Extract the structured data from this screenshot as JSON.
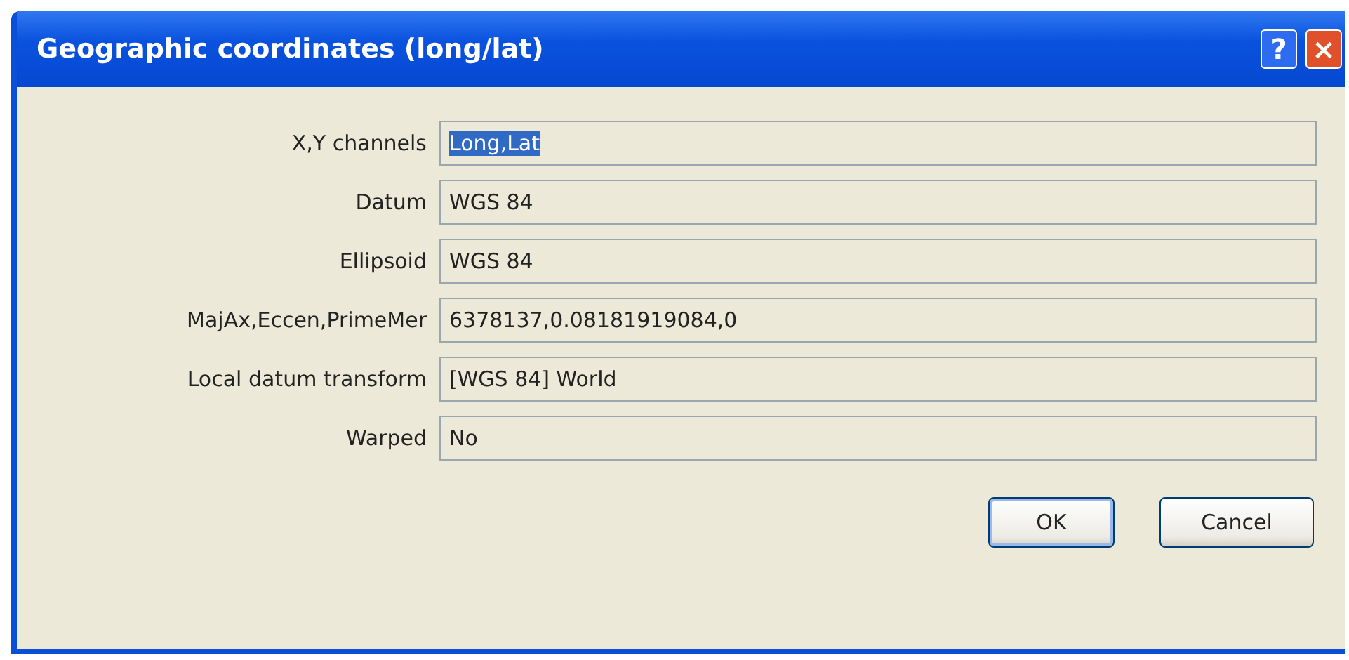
{
  "window": {
    "title": "Geographic coordinates (long/lat)",
    "help_button": "?",
    "close_button": "×"
  },
  "fields": [
    {
      "label": "X,Y channels",
      "value": "Long,Lat",
      "selected": true
    },
    {
      "label": "Datum",
      "value": "WGS 84",
      "selected": false
    },
    {
      "label": "Ellipsoid",
      "value": "WGS 84",
      "selected": false
    },
    {
      "label": "MajAx,Eccen,PrimeMer",
      "value": "6378137,0.08181919084,0",
      "selected": false
    },
    {
      "label": "Local datum transform",
      "value": "[WGS 84] World",
      "selected": false
    },
    {
      "label": "Warped",
      "value": "No",
      "selected": false
    }
  ],
  "buttons": [
    {
      "label": "OK",
      "kind": "default"
    },
    {
      "label": "Cancel",
      "kind": "normal"
    }
  ]
}
